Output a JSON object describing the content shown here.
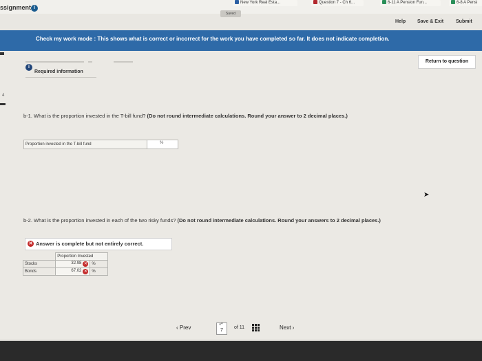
{
  "browser": {
    "tabs": [
      {
        "label": "New York Real Esta...",
        "color": "#2b5fa3"
      },
      {
        "label": "Question 7 - Ch 6...",
        "color": "#b2282d"
      },
      {
        "label": "6-11 A Pension Fun...",
        "color": "#2a8f59"
      },
      {
        "label": "6-8 A Pensi",
        "color": "#2a8f59"
      }
    ]
  },
  "header": {
    "title": "ssignment",
    "saved": "Saved",
    "help": "Help",
    "save_exit": "Save & Exit",
    "submit": "Submit"
  },
  "banner": {
    "text": "Check my work mode : This shows what is correct or incorrect for the work you have completed so far. It does not indicate completion."
  },
  "nav": {
    "return": "Return to question",
    "left_number": "4"
  },
  "required": {
    "badge": "i",
    "label": "Required information"
  },
  "q1": {
    "text": "b-1. What is the proportion invested in the T-bill fund? ",
    "note": "(Do not round intermediate calculations. Round your answer to 2 decimal places.)",
    "field_label": "Proportion invested in the T-bill fund",
    "unit": "%"
  },
  "q2": {
    "text": "b-2. What is the proportion invested in each of the two risky funds? ",
    "note": "(Do not round intermediate calculations. Round your answers to 2 decimal places.)"
  },
  "answer_status": {
    "text": "Answer is complete but not entirely correct."
  },
  "table": {
    "header": "Proportion Invested",
    "rows": [
      {
        "label": "Stocks",
        "value": "32.98",
        "unit": "%"
      },
      {
        "label": "Bonds",
        "value": "67.02",
        "unit": "%"
      }
    ]
  },
  "pager": {
    "prev": "Prev",
    "current": "7",
    "of": "of 11",
    "next": "Next"
  }
}
